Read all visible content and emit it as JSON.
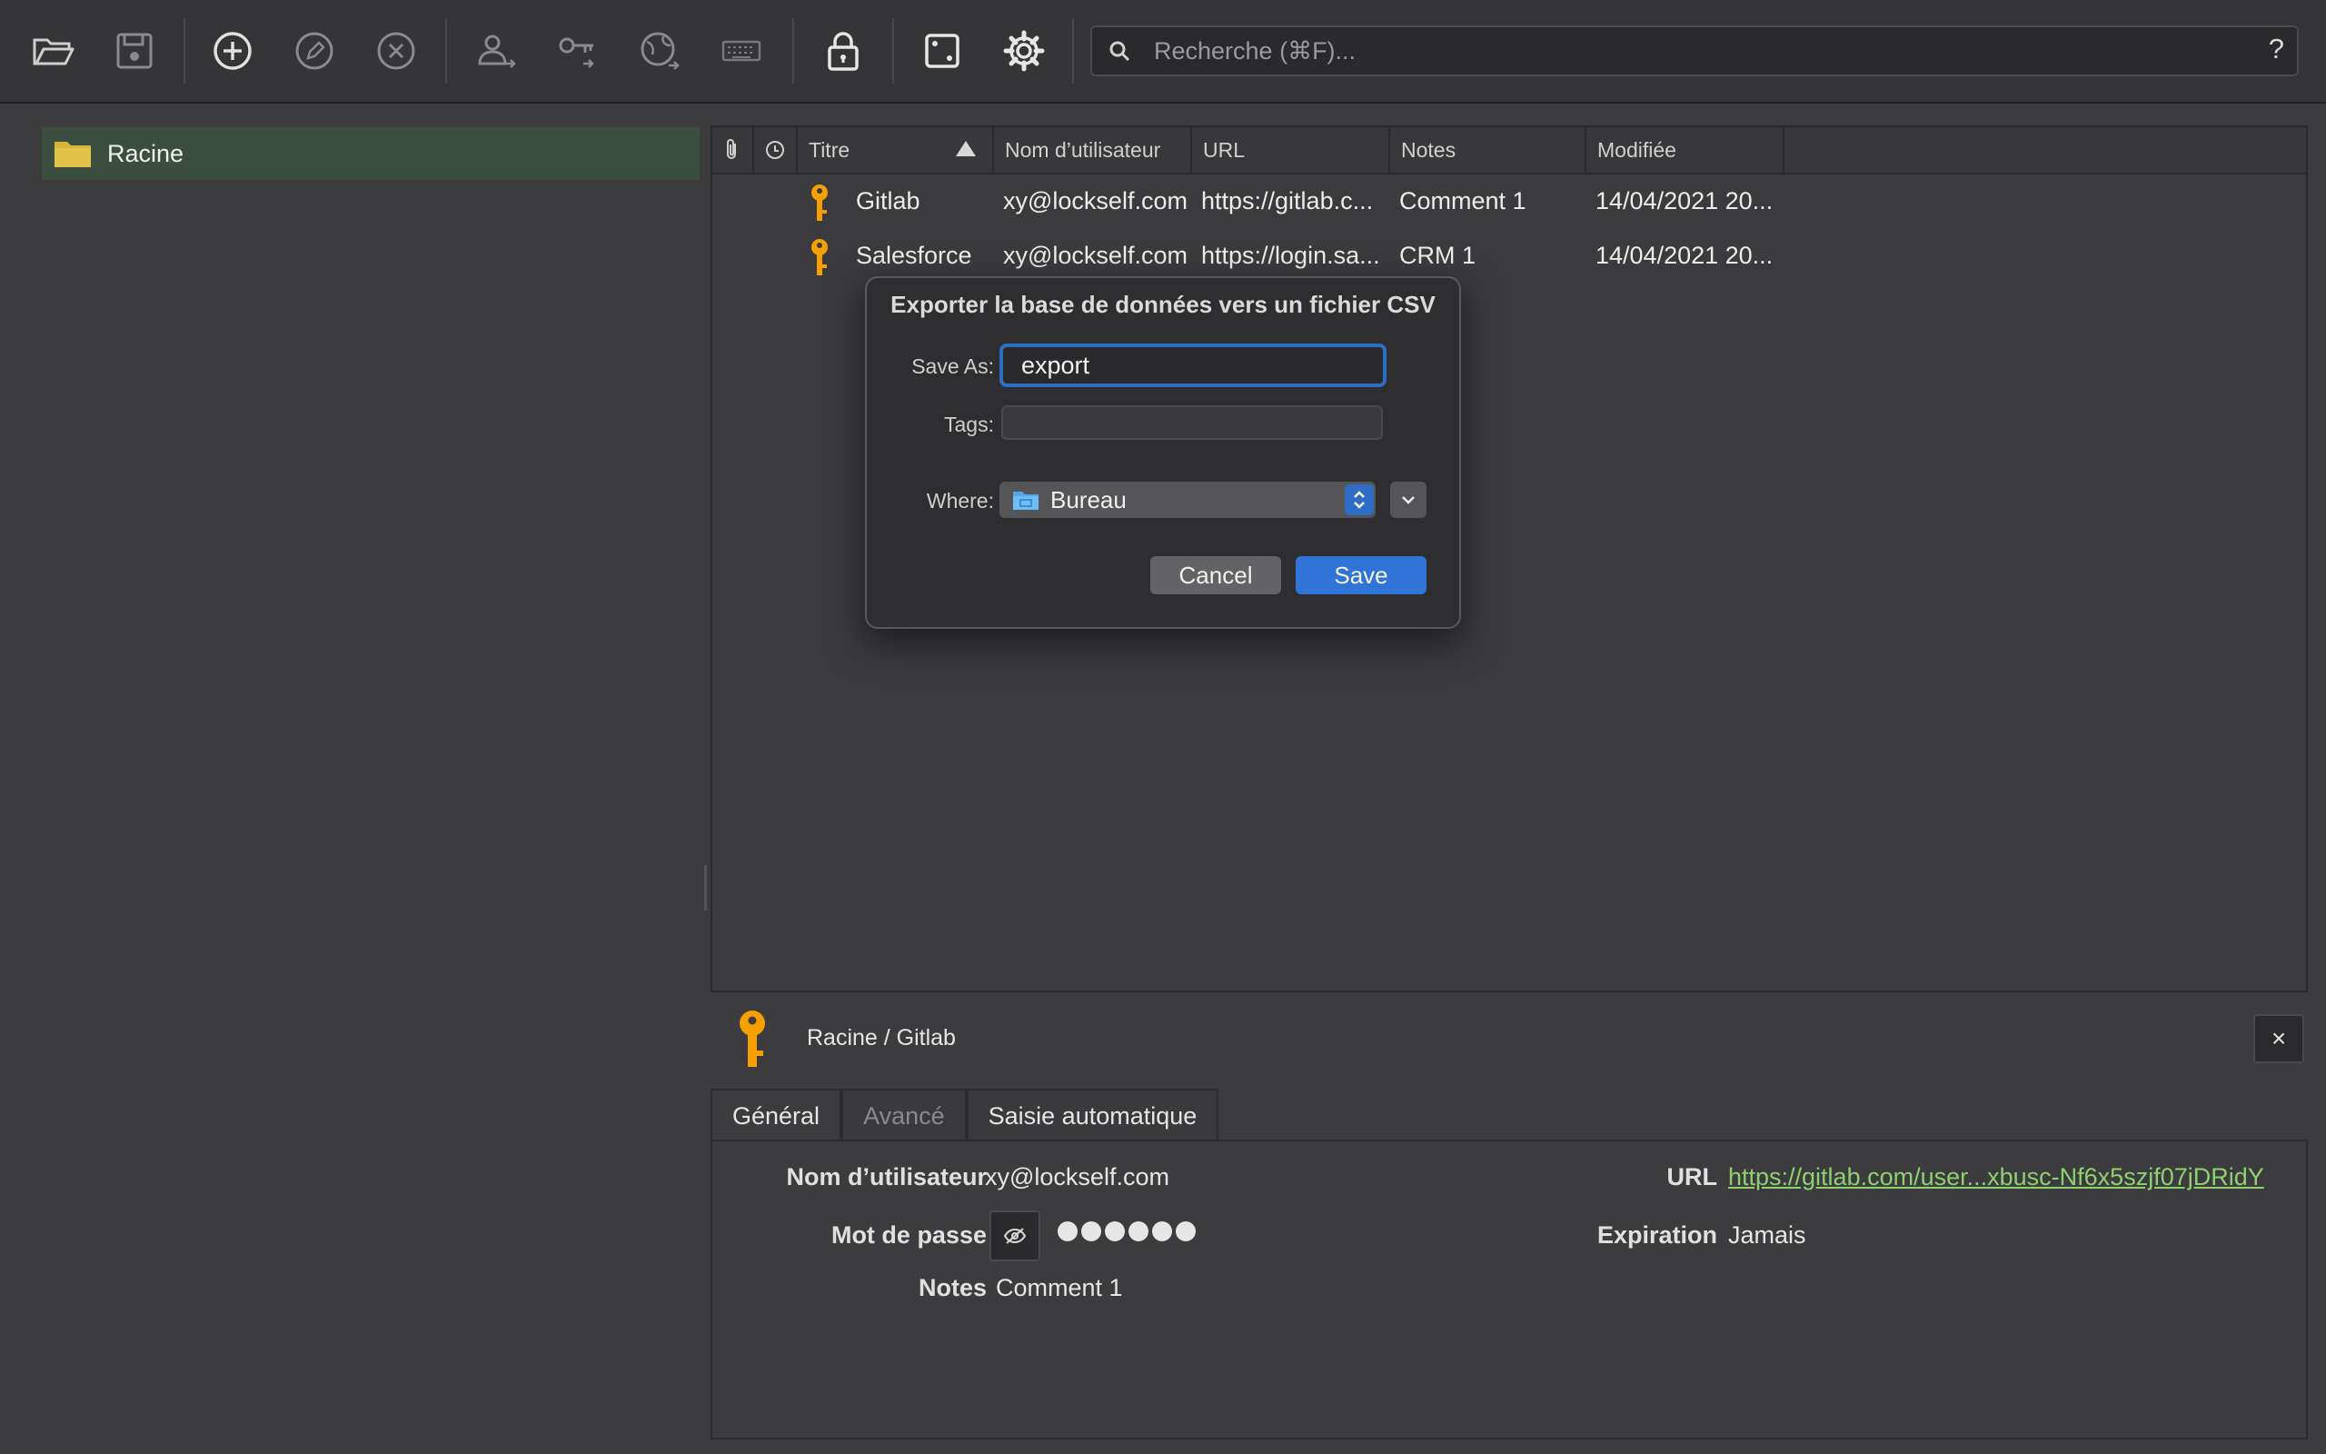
{
  "toolbar": {
    "icons": [
      {
        "name": "open-folder-icon"
      },
      {
        "name": "save-disk-icon"
      },
      {
        "name": "add-entry-icon"
      },
      {
        "name": "edit-entry-icon"
      },
      {
        "name": "delete-entry-icon"
      },
      {
        "name": "copy-username-icon"
      },
      {
        "name": "copy-password-icon"
      },
      {
        "name": "open-url-icon"
      },
      {
        "name": "autotype-keyboard-icon"
      },
      {
        "name": "lock-icon"
      },
      {
        "name": "password-generator-dice-icon"
      },
      {
        "name": "settings-gear-icon"
      }
    ],
    "search_placeholder": "Recherche (⌘F)...",
    "help_label": "?"
  },
  "sidebar": {
    "root_label": "Racine"
  },
  "table": {
    "columns": {
      "title": "Titre",
      "username": "Nom d’utilisateur",
      "url": "URL",
      "notes": "Notes",
      "modified": "Modifiée"
    },
    "rows": [
      {
        "title": "Gitlab",
        "username": "xy@lockself.com",
        "url": "https://gitlab.c...",
        "notes": "Comment 1",
        "modified": "14/04/2021 20..."
      },
      {
        "title": "Salesforce",
        "username": "xy@lockself.com",
        "url": "https://login.sa...",
        "notes": "CRM 1",
        "modified": "14/04/2021 20..."
      }
    ]
  },
  "dialog": {
    "title": "Exporter la base de données vers un fichier CSV",
    "save_as_label": "Save As:",
    "save_as_value": "export",
    "tags_label": "Tags:",
    "where_label": "Where:",
    "where_value": "Bureau",
    "cancel_label": "Cancel",
    "save_label": "Save"
  },
  "detail": {
    "path": "Racine / Gitlab",
    "close_label": "×",
    "tabs": [
      {
        "label": "Général"
      },
      {
        "label": "Avancé"
      },
      {
        "label": "Saisie automatique"
      }
    ],
    "username_label": "Nom d’utilisateur",
    "username_value": "xy@lockself.com",
    "password_label": "Mot de passe",
    "notes_label": "Notes",
    "notes_value": "Comment 1",
    "url_label": "URL",
    "url_value": "https://gitlab.com/user...xbusc-Nf6x5szjf07jDRidY",
    "expiration_label": "Expiration",
    "expiration_value": "Jamais"
  },
  "colors": {
    "accent_blue": "#2f74d6",
    "key_orange": "#f5a000",
    "folder_yellow": "#d8b43a",
    "link_green": "#8fd06f"
  }
}
